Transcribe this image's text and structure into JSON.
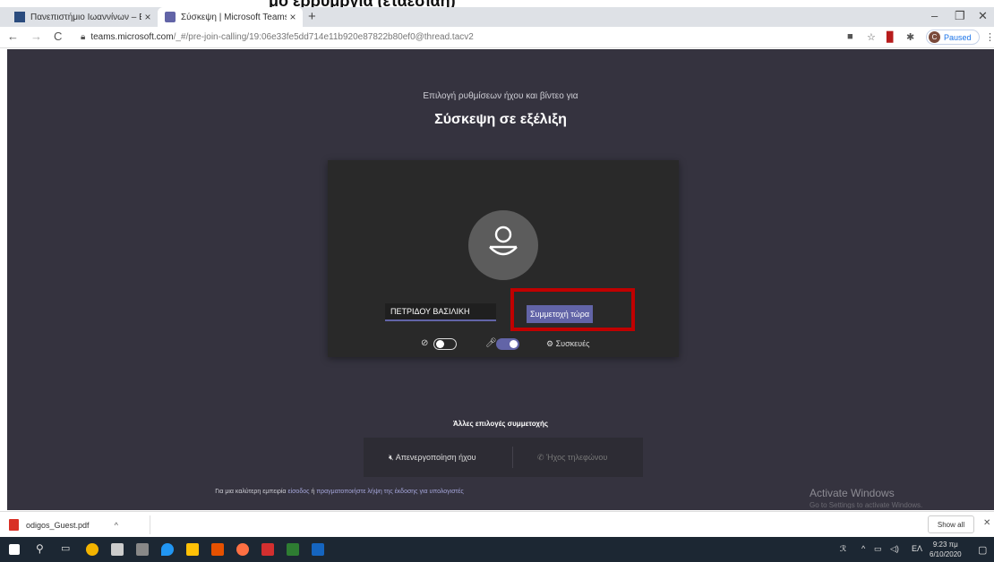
{
  "top_strip_text": "μο ερρυμργια (εταεσιαη)",
  "browser": {
    "tabs": [
      {
        "title": "Πανεπιστήμιο Ιωαννίνων – Επισ",
        "active": false
      },
      {
        "title": "Σύσκεψη | Microsoft Teams",
        "active": true
      }
    ],
    "new_tab": "+",
    "url_host": "teams.microsoft.com",
    "url_path": "/_#/pre-join-calling/19:06e33fe5dd714e11b920e87822b80ef0@thread.tacv2",
    "profile_initial": "C",
    "profile_status": "Paused"
  },
  "teams": {
    "subtitle": "Επιλογή ρυθμίσεων ήχου και βίντεο για",
    "title": "Σύσκεψη σε εξέλιξη",
    "name_value": "ΠΕΤΡΙΔΟΥ ΒΑΣΙΛΙΚΗ",
    "join_label": "Συμμετοχή τώρα",
    "camera_on": false,
    "mic_on": true,
    "devices_label": "Συσκευές",
    "other_options_title": "Άλλες επιλογές συμμετοχής",
    "audio_off_label": "Απενεργοποίηση ήχου",
    "phone_audio_label": "Ήχος τηλεφώνου",
    "bottom_text_prefix": "Για μια καλύτερη εμπειρία",
    "bottom_link_signin": "είσοδος",
    "bottom_text_or": "ή",
    "bottom_link_download": "πραγματοποιήστε λήψη της έκδοσης για υπολογιστές",
    "activate_title": "Activate Windows",
    "activate_sub": "Go to Settings to activate Windows."
  },
  "downloads": {
    "file_name": "odigos_Guest.pdf",
    "show_all": "Show all"
  },
  "taskbar": {
    "lang": "ΕΛ",
    "time": "9:23 πμ",
    "date": "6/10/2020"
  },
  "colors": {
    "teams_bg": "#35333f",
    "accent": "#6264a7",
    "highlight": "#c00000"
  }
}
